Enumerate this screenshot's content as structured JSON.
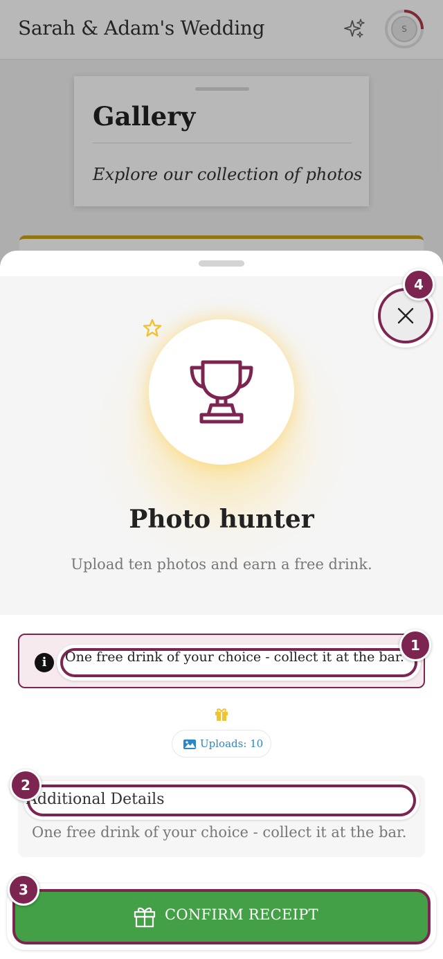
{
  "background": {
    "app_title": "Sarah & Adam's Wedding",
    "avatar_initial": "S",
    "gallery": {
      "title": "Gallery",
      "subtitle": "Explore our collection of photos"
    }
  },
  "sheet": {
    "achievement_title": "Photo hunter",
    "achievement_description": "Upload ten photos and earn a free drink.",
    "info_text": "One free drink of your choice - collect it at the bar.",
    "uploads_label": "Uploads: 10",
    "details_title": "Additional Details",
    "details_text": "One free drink of your choice - collect it at the bar.",
    "confirm_label": "CONFIRM RECEIPT"
  },
  "badges": {
    "info": "1",
    "details": "2",
    "confirm": "3",
    "close": "4"
  },
  "icons": {
    "sparkle": "sparkle-icon",
    "trophy": "trophy-icon",
    "star": "star-icon",
    "close": "close-icon",
    "info": "info-icon",
    "gift": "gift-icon",
    "image": "image-icon"
  },
  "colors": {
    "accent": "#7b2550",
    "confirm_green": "#43a047",
    "gold": "#f2c230",
    "link_blue": "#2a86c8"
  }
}
